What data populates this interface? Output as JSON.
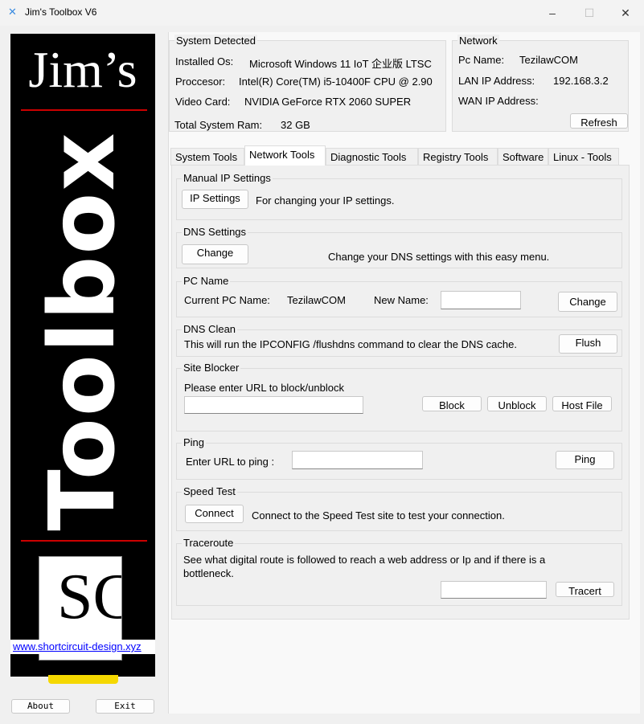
{
  "window": {
    "title": "Jim's Toolbox V6",
    "icon": "tools-icon",
    "minimize": "–",
    "maximize": "☐",
    "close": "✕"
  },
  "sidebar": {
    "brand_top": "Jim’s",
    "brand_vertical": "Toolbox",
    "logo_letters": "SC",
    "logo_link": "www.shortcircuit-design.xyz",
    "about": "About",
    "exit": "Exit"
  },
  "system": {
    "title": "System Detected",
    "os_label": "Installed Os:",
    "os_value": "Microsoft Windows 11 IoT 企业版 LTSC",
    "cpu_label": "Proccesor:",
    "cpu_value": "Intel(R) Core(TM) i5-10400F CPU @ 2.90",
    "gpu_label": "Video Card:",
    "gpu_value": "NVIDIA GeForce RTX 2060 SUPER",
    "ram_label": "Total System Ram:",
    "ram_value": "32 GB"
  },
  "network": {
    "title": "Network",
    "pc_label": "Pc Name:",
    "pc_value": "TezilawCOM",
    "lan_label": "LAN IP Address:",
    "lan_value": "192.168.3.2",
    "wan_label": "WAN IP Address:",
    "wan_value": "",
    "refresh": "Refresh"
  },
  "tabs": [
    "System Tools",
    "Network Tools",
    "Diagnostic Tools",
    "Registry Tools",
    "Software",
    "Linux - Tools"
  ],
  "active_tab": "Network Tools",
  "sections": {
    "manual_ip": {
      "title": "Manual IP Settings",
      "button": "IP Settings",
      "desc": "For changing your IP settings."
    },
    "dns": {
      "title": "DNS Settings",
      "button": "Change",
      "desc": "Change your DNS settings with this easy menu."
    },
    "pcname": {
      "title": "PC Name",
      "current_label": "Current PC Name:",
      "current_value": "TezilawCOM",
      "new_label": "New Name:",
      "new_value": "",
      "button": "Change"
    },
    "dnsclean": {
      "title": "DNS Clean",
      "desc": "This will run the IPCONFIG /flushdns command to clear the DNS cache.",
      "button": "Flush"
    },
    "blocker": {
      "title": "Site Blocker",
      "prompt": "Please enter URL to block/unblock",
      "value": "",
      "block": "Block",
      "unblock": "Unblock",
      "hostfile": "Host File"
    },
    "ping": {
      "title": "Ping",
      "prompt": "Enter URL to ping :",
      "value": "",
      "button": "Ping"
    },
    "speed": {
      "title": "Speed Test",
      "button": "Connect",
      "desc": "Connect to the Speed Test site to test your connection."
    },
    "trace": {
      "title": "Traceroute",
      "desc": "See what digital route is followed to reach a web address or Ip and if there is a bottleneck.",
      "value": "",
      "button": "Tracert"
    }
  }
}
